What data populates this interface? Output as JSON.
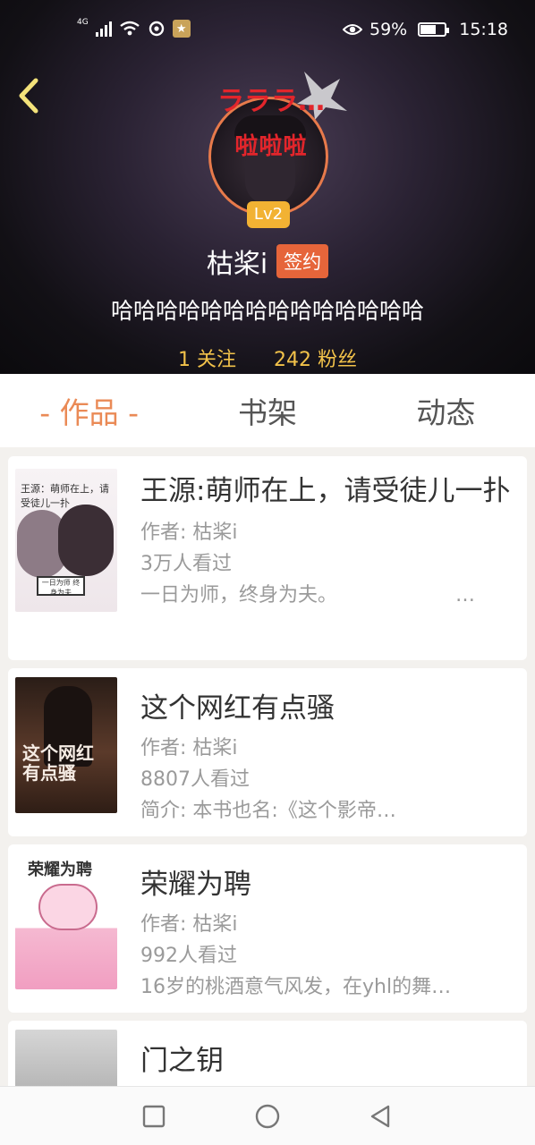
{
  "status_bar": {
    "network": "4G",
    "battery_percent": "59%",
    "battery_level": 0.59,
    "time": "15:18"
  },
  "profile": {
    "avatar_overlay_top": "ラララ…",
    "avatar_overlay_text": "啦啦啦",
    "level": "Lv2",
    "name": "枯桨i",
    "sign_badge": "签约",
    "bio": "哈哈哈哈哈哈哈哈哈哈哈哈哈哈",
    "following": "1 关注",
    "followers": "242 粉丝"
  },
  "tabs": [
    {
      "label": "- 作品 -",
      "active": true
    },
    {
      "label": "书架",
      "active": false
    },
    {
      "label": "动态",
      "active": false
    }
  ],
  "books": [
    {
      "title": "王源:萌师在上，请受徒儿一扑",
      "author": "作者: 枯桨i",
      "views": "3万人看过",
      "desc": "一日为师，终身为夫。",
      "more": "…",
      "cover_title": "王源：萌师在上，请受徒儿一扑",
      "cover_box": "一日为师 终身为夫"
    },
    {
      "title": "这个网红有点骚",
      "author": "作者: 枯桨i",
      "views": "8807人看过",
      "desc": "简介: 本书也名:《这个影帝…",
      "cover_title": "这个网红 有点骚"
    },
    {
      "title": "荣耀为聘",
      "author": "作者: 枯桨i",
      "views": "992人看过",
      "desc": "16岁的桃酒意气风发，在yhl的舞…",
      "cover_title": "荣耀为聘"
    },
    {
      "title": "门之钥"
    }
  ],
  "colors": {
    "accent": "#ea8a56",
    "badge": "#e6653a",
    "level": "#f2b233",
    "stats": "#f2c24a"
  }
}
